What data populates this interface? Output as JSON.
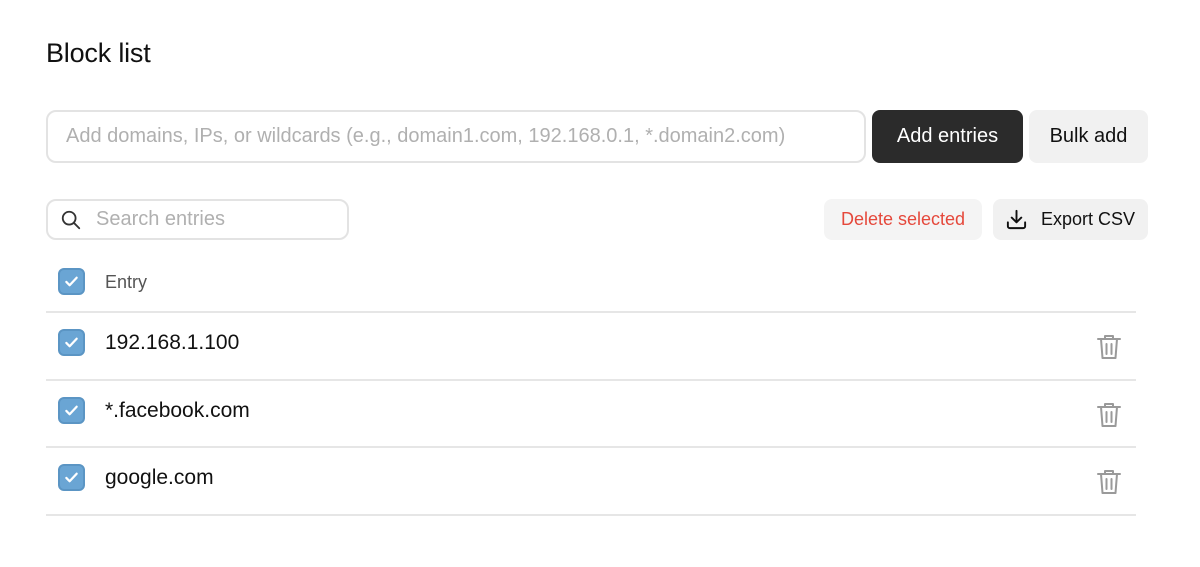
{
  "page": {
    "title": "Block list"
  },
  "add_form": {
    "input_value": "",
    "input_placeholder": "Add domains, IPs, or wildcards (e.g., domain1.com, 192.168.0.1, *.domain2.com)",
    "add_label": "Add entries",
    "bulk_label": "Bulk add"
  },
  "toolbar": {
    "search_value": "",
    "search_placeholder": "Search entries",
    "delete_label": "Delete selected",
    "export_label": "Export CSV",
    "search_icon": "search-icon",
    "export_icon": "download-icon"
  },
  "table": {
    "column_header": "Entry",
    "select_all_checked": true,
    "rows": [
      {
        "entry": "192.168.1.100",
        "checked": true,
        "action_icon": "trash-icon"
      },
      {
        "entry": "*.facebook.com",
        "checked": true,
        "action_icon": "trash-icon"
      },
      {
        "entry": "google.com",
        "checked": true,
        "action_icon": "trash-icon"
      }
    ]
  },
  "colors": {
    "primary_button": "#2b2b2b",
    "danger_text": "#e5483b",
    "checkbox_fill": "#6aa5d4",
    "border": "#e3e3e3",
    "placeholder": "#b0b0b0"
  }
}
